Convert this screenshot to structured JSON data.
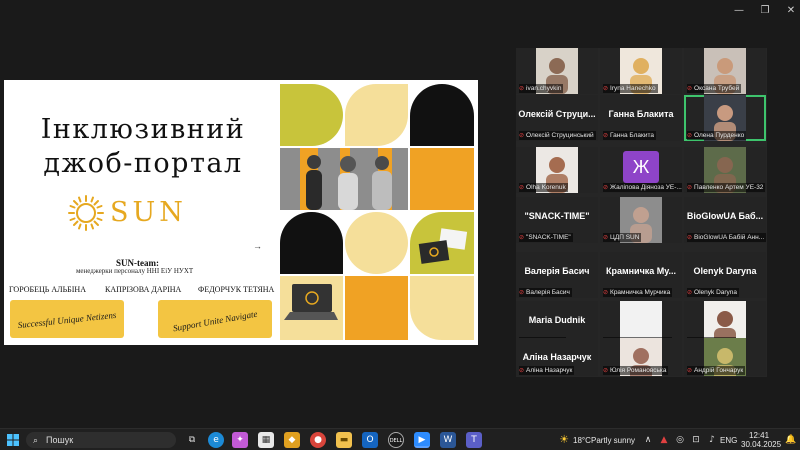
{
  "window": {
    "minimize": "—",
    "maximize": "❐",
    "close": "✕"
  },
  "slide": {
    "title_line1": "Інклюзивний",
    "title_line2": "джоб-портал",
    "brand": "SUN",
    "team_title": "SUN-team:",
    "team_subtitle": "менеджерки персоналу ННІ ЕіУ НУХТ",
    "members": [
      "ГОРОБЕЦЬ АЛЬБІНА",
      "КАПРІЗОВА ДАРІНА",
      "ФЕДОРЧУК ТЕТЯНА"
    ],
    "banner_left": "Successful Unique Netizens",
    "banner_right": "Support Unite Navigate",
    "arrow": "→"
  },
  "participants": [
    {
      "label": "ivan.chyvkin",
      "big": "",
      "kind": "video"
    },
    {
      "label": "Iryna Hanechko",
      "big": "",
      "kind": "video"
    },
    {
      "label": "Оксана Трубей",
      "big": "",
      "kind": "video"
    },
    {
      "label": "Олексій Струцинський",
      "big": "Олексій Струци...",
      "kind": "name"
    },
    {
      "label": "Ганна Блакита",
      "big": "Ганна Блакита",
      "kind": "name"
    },
    {
      "label": "Олена Пурденко",
      "big": "",
      "kind": "video"
    },
    {
      "label": "Olha Korenuk",
      "big": "",
      "kind": "video"
    },
    {
      "label": "Жаліпова Діяноза  УЕ-...",
      "big": "Ж",
      "kind": "avatar"
    },
    {
      "label": "Павленко Артем УЕ-32",
      "big": "",
      "kind": "video"
    },
    {
      "label": "\"SNACK-TIME\"",
      "big": "\"SNACK-TIME\"",
      "kind": "name"
    },
    {
      "label": "ЦДП SUN",
      "big": "",
      "kind": "video"
    },
    {
      "label": "BioGlowUA Бабій Анн...",
      "big": "BioGlowUA Баб...",
      "kind": "name"
    },
    {
      "label": "Валерія Басич",
      "big": "Валерія Басич",
      "kind": "name"
    },
    {
      "label": "Крамничка Мурчика",
      "big": "Крамничка Му...",
      "kind": "name"
    },
    {
      "label": "Olenyk Daryna",
      "big": "Olenyk Daryna",
      "kind": "name"
    },
    {
      "label": "Maria Dudnik",
      "big": "Maria Dudnik",
      "kind": "name"
    },
    {
      "label": "Артем Александров",
      "big": "",
      "kind": "video"
    },
    {
      "label": "Uliana Sytailo",
      "big": "",
      "kind": "video"
    },
    {
      "label": "Аліна Назарчук",
      "big": "Аліна Назарчук",
      "kind": "name"
    },
    {
      "label": "Юлія Романовська",
      "big": "",
      "kind": "video"
    },
    {
      "label": "Андрій Гончарук",
      "big": "",
      "kind": "video"
    }
  ],
  "taskbar": {
    "search_placeholder": "Пошук",
    "weather_temp": "18°C",
    "weather_text": "Partly sunny",
    "language": "ENG",
    "time": "12:41",
    "date": "30.04.2025"
  },
  "colors": {
    "accent_green": "#3ec46d",
    "sun_gold": "#e6a820",
    "banner_yellow": "#f3c542",
    "muted_red": "#e04040"
  }
}
